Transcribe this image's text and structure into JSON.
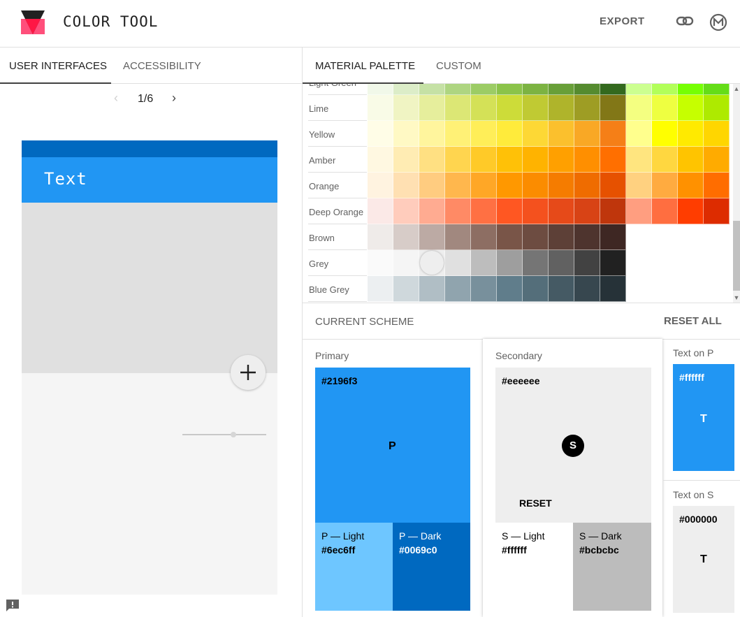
{
  "header": {
    "title": "COLOR TOOL",
    "export_label": "EXPORT",
    "logo_colors": {
      "top": "#212121",
      "bottom": "#ff4f7b",
      "overlap": "#ff1744"
    }
  },
  "left_tabs": [
    {
      "label": "USER INTERFACES",
      "active": true
    },
    {
      "label": "ACCESSIBILITY",
      "active": false
    }
  ],
  "pager": {
    "text": "1/6"
  },
  "mockup": {
    "appbar_text": "Text",
    "colors": {
      "status": "#0069c0",
      "appbar": "#2196f3",
      "hero": "#e0e0e0",
      "body": "#f5f5f5"
    }
  },
  "right_tabs": [
    {
      "label": "MATERIAL PALETTE",
      "active": true
    },
    {
      "label": "CUSTOM",
      "active": false
    }
  ],
  "palette": {
    "rows": [
      {
        "label": "Light Green",
        "colors": [
          "#f1f8e9",
          "#dcedc8",
          "#c5e1a5",
          "#aed581",
          "#9ccc65",
          "#8bc34a",
          "#7cb342",
          "#689f38",
          "#558b2f",
          "#33691e",
          "#ccff90",
          "#b2ff59",
          "#76ff03",
          "#64dd17"
        ]
      },
      {
        "label": "Lime",
        "colors": [
          "#f9fbe7",
          "#f0f4c3",
          "#e6ee9c",
          "#dce775",
          "#d4e157",
          "#cddc39",
          "#c0ca33",
          "#afb42b",
          "#9e9d24",
          "#827717",
          "#f4ff81",
          "#eeff41",
          "#c6ff00",
          "#aeea00"
        ]
      },
      {
        "label": "Yellow",
        "colors": [
          "#fffde7",
          "#fff9c4",
          "#fff59d",
          "#fff176",
          "#ffee58",
          "#ffeb3b",
          "#fdd835",
          "#fbc02d",
          "#f9a825",
          "#f57f17",
          "#ffff8d",
          "#ffff00",
          "#ffea00",
          "#ffd600"
        ]
      },
      {
        "label": "Amber",
        "colors": [
          "#fff8e1",
          "#ffecb3",
          "#ffe082",
          "#ffd54f",
          "#ffca28",
          "#ffc107",
          "#ffb300",
          "#ffa000",
          "#ff8f00",
          "#ff6f00",
          "#ffe57f",
          "#ffd740",
          "#ffc400",
          "#ffab00"
        ]
      },
      {
        "label": "Orange",
        "colors": [
          "#fff3e0",
          "#ffe0b2",
          "#ffcc80",
          "#ffb74d",
          "#ffa726",
          "#ff9800",
          "#fb8c00",
          "#f57c00",
          "#ef6c00",
          "#e65100",
          "#ffd180",
          "#ffab40",
          "#ff9100",
          "#ff6d00"
        ]
      },
      {
        "label": "Deep Orange",
        "colors": [
          "#fbe9e7",
          "#ffccbc",
          "#ffab91",
          "#ff8a65",
          "#ff7043",
          "#ff5722",
          "#f4511e",
          "#e64a19",
          "#d84315",
          "#bf360c",
          "#ff9e80",
          "#ff6e40",
          "#ff3d00",
          "#dd2c00"
        ]
      },
      {
        "label": "Brown",
        "colors": [
          "#efebe9",
          "#d7ccc8",
          "#bcaaa4",
          "#a1887f",
          "#8d6e63",
          "#795548",
          "#6d4c41",
          "#5d4037",
          "#4e342e",
          "#3e2723"
        ]
      },
      {
        "label": "Grey",
        "colors": [
          "#fafafa",
          "#f5f5f5",
          "#eeeeee",
          "#e0e0e0",
          "#bdbdbd",
          "#9e9e9e",
          "#757575",
          "#616161",
          "#424242",
          "#212121"
        ],
        "selected_index": 2
      },
      {
        "label": "Blue Grey",
        "colors": [
          "#eceff1",
          "#cfd8dc",
          "#b0bec5",
          "#90a4ae",
          "#78909c",
          "#607d8b",
          "#546e7a",
          "#455a64",
          "#37474f",
          "#263238"
        ]
      }
    ]
  },
  "scheme": {
    "title": "CURRENT SCHEME",
    "reset_all_label": "RESET ALL",
    "primary": {
      "title": "Primary",
      "hex": "#2196f3",
      "letter": "P",
      "light": {
        "title": "P — Light",
        "hex": "#6ec6ff"
      },
      "dark": {
        "title": "P — Dark",
        "hex": "#0069c0"
      }
    },
    "secondary": {
      "title": "Secondary",
      "hex": "#eeeeee",
      "letter": "S",
      "reset_label": "RESET",
      "light": {
        "title": "S — Light",
        "hex": "#ffffff"
      },
      "dark": {
        "title": "S — Dark",
        "hex": "#bcbcbc"
      }
    },
    "text_on_p": {
      "title": "Text on P",
      "hex": "#ffffff",
      "letter": "T"
    },
    "text_on_s": {
      "title": "Text on S",
      "hex": "#000000",
      "letter": "T"
    }
  }
}
